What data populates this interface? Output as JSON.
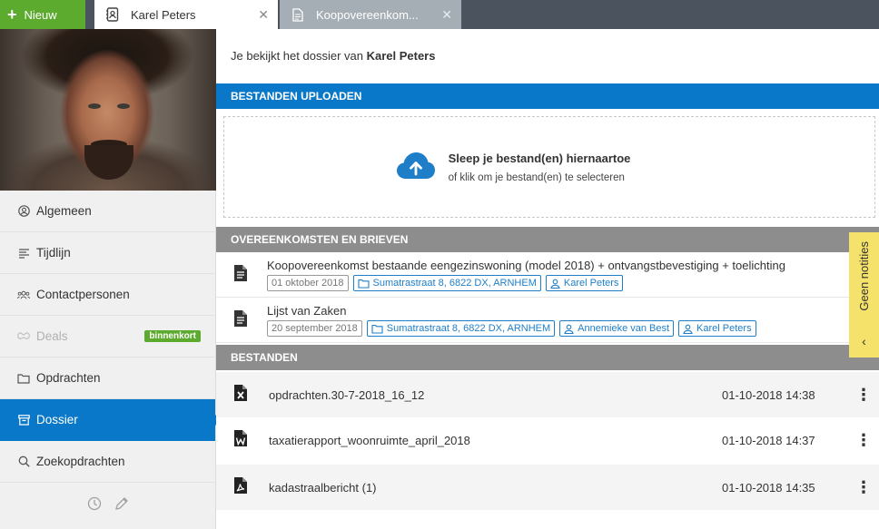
{
  "topbar": {
    "new_label": "Nieuw",
    "tabs": [
      {
        "label": "Karel Peters",
        "icon": "contact-card-icon",
        "active": true
      },
      {
        "label": "Koopovereenkom...",
        "icon": "document-icon",
        "active": false
      }
    ],
    "close_glyph": "✕"
  },
  "sidebar": {
    "items": [
      {
        "label": "Algemeen",
        "icon": "user-circle-icon"
      },
      {
        "label": "Tijdlijn",
        "icon": "timeline-icon"
      },
      {
        "label": "Contactpersonen",
        "icon": "users-icon"
      },
      {
        "label": "Deals",
        "icon": "handshake-icon",
        "disabled": true,
        "badge": "binnenkort"
      },
      {
        "label": "Opdrachten",
        "icon": "folder-icon"
      },
      {
        "label": "Dossier",
        "icon": "archive-icon",
        "active": true
      },
      {
        "label": "Zoekopdrachten",
        "icon": "search-icon"
      }
    ]
  },
  "main": {
    "intro_prefix": "Je bekijkt het dossier van",
    "intro_name": "Karel Peters",
    "upload": {
      "heading": "BESTANDEN UPLOADEN",
      "title": "Sleep je bestand(en) hiernaartoe",
      "subtitle": "of klik om je bestand(en) te selecteren"
    },
    "agreements": {
      "heading": "OVEREENKOMSTEN EN BRIEVEN",
      "rows": [
        {
          "title": "Koopovereenkomst bestaande eengezinswoning (model 2018) + ontvangstbevestiging + toelichting",
          "date": "01 oktober 2018",
          "address": "Sumatrastraat 8, 6822 DX, ARNHEM",
          "persons": [
            "Karel Peters"
          ]
        },
        {
          "title": "Lijst van Zaken",
          "date": "20 september 2018",
          "address": "Sumatrastraat 8, 6822 DX, ARNHEM",
          "persons": [
            "Annemieke van Best",
            "Karel Peters"
          ]
        }
      ]
    },
    "files": {
      "heading": "BESTANDEN",
      "rows": [
        {
          "name": "opdrachten.30-7-2018_16_12",
          "date": "01-10-2018 14:38",
          "icon": "excel-file-icon"
        },
        {
          "name": "taxatierapport_woonruimte_april_2018",
          "date": "01-10-2018 14:37",
          "icon": "word-file-icon"
        },
        {
          "name": "kadastraalbericht (1)",
          "date": "01-10-2018 14:35",
          "icon": "pdf-file-icon"
        }
      ],
      "menu_glyph": "⋮"
    },
    "notifications": {
      "label": "Geen notities",
      "chevron": "‹"
    }
  },
  "colors": {
    "brand_blue": "#0a78c8",
    "green": "#5cab2e",
    "section_gray": "#8d8d8d",
    "notif_yellow": "#f4e26b",
    "topbar": "#4b545e"
  }
}
